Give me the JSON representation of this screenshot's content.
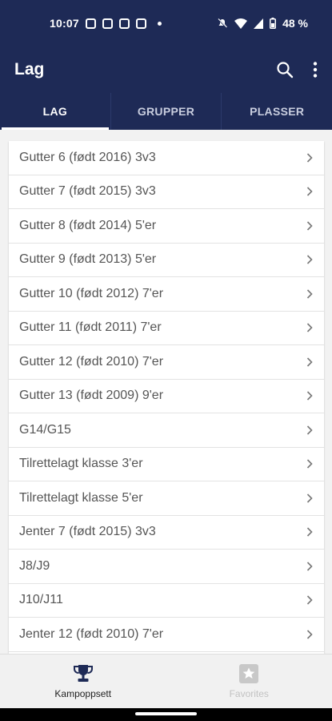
{
  "statusbar": {
    "time": "10:07",
    "battery": "48 %"
  },
  "appbar": {
    "title": "Lag"
  },
  "tabs": [
    {
      "label": "LAG",
      "active": true
    },
    {
      "label": "GRUPPER",
      "active": false
    },
    {
      "label": "PLASSER",
      "active": false
    }
  ],
  "list": {
    "items": [
      "Gutter 6 (født 2016) 3v3",
      "Gutter 7 (født 2015) 3v3",
      "Gutter 8 (født 2014) 5'er",
      "Gutter 9 (født 2013) 5'er",
      "Gutter 10 (født 2012) 7'er",
      "Gutter 11 (født 2011) 7'er",
      "Gutter 12 (født 2010) 7'er",
      "Gutter 13 (født 2009) 9'er",
      "G14/G15",
      "Tilrettelagt klasse 3'er",
      "Tilrettelagt klasse 5'er",
      "Jenter 7 (født 2015) 3v3",
      "J8/J9",
      "J10/J11",
      "Jenter 12 (født 2010) 7'er"
    ]
  },
  "bottomnav": {
    "items": [
      {
        "label": "Kampoppsett",
        "icon": "trophy-icon",
        "active": true
      },
      {
        "label": "Favorites",
        "icon": "star-icon",
        "active": false
      }
    ]
  },
  "colors": {
    "primary": "#1e2a56",
    "background": "#f2f2f2",
    "text": "#555555"
  }
}
